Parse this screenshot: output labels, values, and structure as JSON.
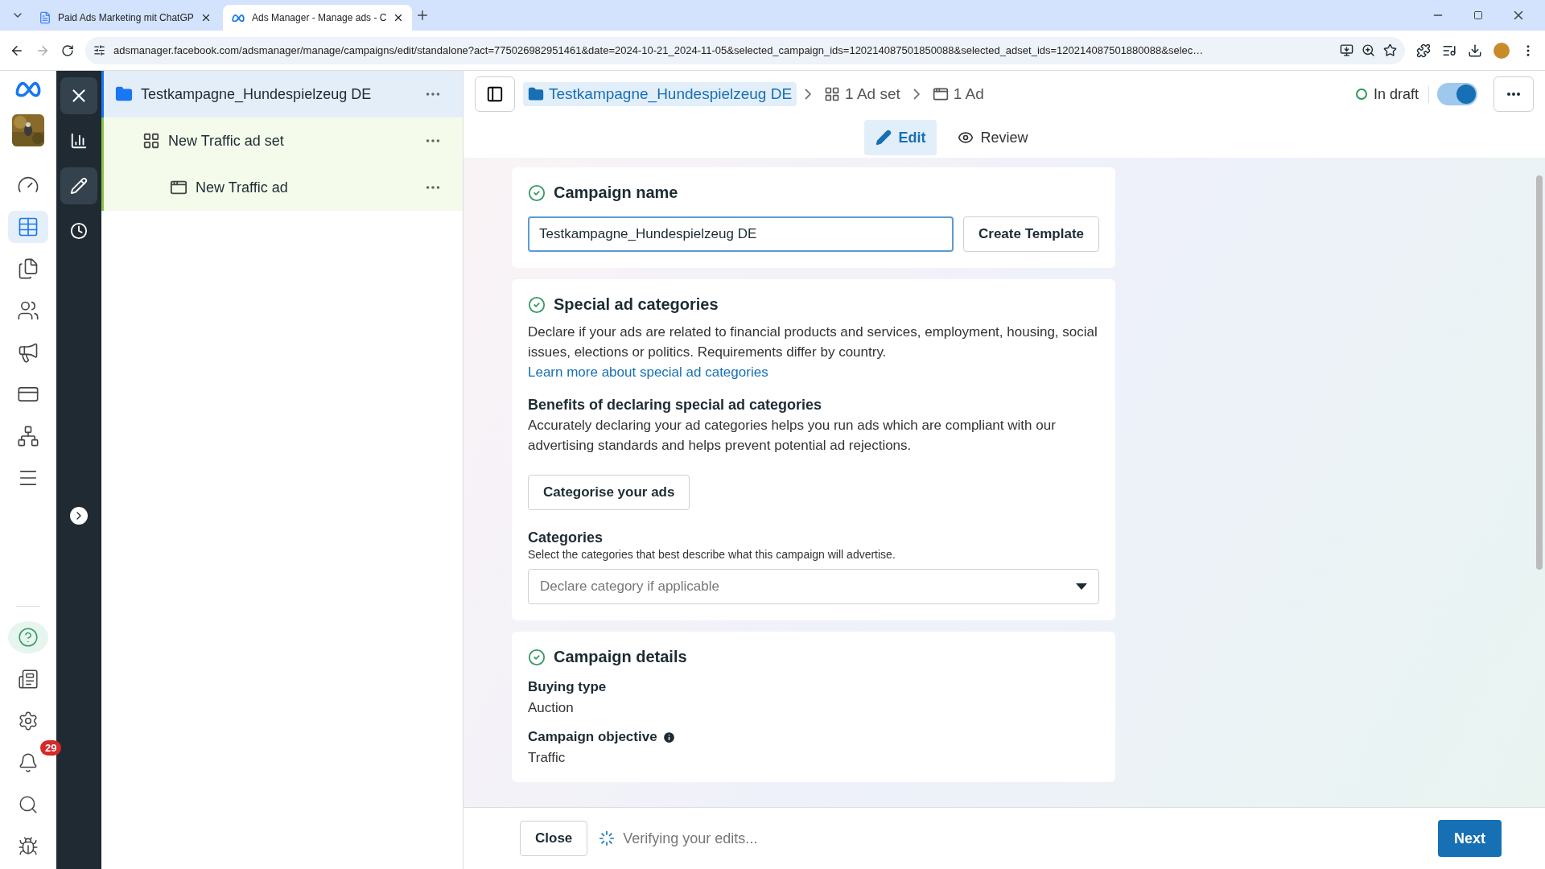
{
  "browser": {
    "tabs": [
      {
        "title": "Paid Ads Marketing mit ChatGP",
        "selected": false
      },
      {
        "title": "Ads Manager - Manage ads - C",
        "selected": true
      }
    ],
    "url": "adsmanager.facebook.com/adsmanager/manage/campaigns/edit/standalone?act=775026982951461&date=2024-10-21_2024-11-05&selected_campaign_ids=120214087501850088&selected_adset_ids=120214087501880088&selec…"
  },
  "rail": {
    "top_items": [
      {
        "selected": false
      },
      {
        "selected": true
      },
      {
        "selected": false
      },
      {
        "selected": false
      },
      {
        "selected": false
      },
      {
        "selected": false
      },
      {
        "selected": false
      },
      {
        "selected": false
      }
    ],
    "bottom_items": [
      {
        "selected": true
      },
      {
        "selected": false
      },
      {
        "selected": false
      },
      {
        "selected": false,
        "badge": "29"
      },
      {
        "selected": false
      },
      {
        "selected": false
      }
    ]
  },
  "tool_rail": {
    "items": [
      {
        "selected": false
      },
      {
        "selected": true
      },
      {
        "selected": false
      }
    ]
  },
  "tree": [
    {
      "name": "Testkampagne_Hundespielzeug DE",
      "kind": "campaign",
      "selected": true,
      "children": [
        {
          "name": "New Traffic ad set",
          "kind": "adset",
          "selected": false,
          "children": [
            {
              "name": "New Traffic ad",
              "kind": "ad",
              "selected": false
            }
          ]
        }
      ]
    }
  ],
  "header": {
    "breadcrumbs": [
      {
        "label": "Testkampagne_Hundespielzeug DE",
        "kind": "campaign",
        "selected": true
      },
      {
        "label": "1 Ad set",
        "kind": "adset",
        "selected": false
      },
      {
        "label": "1 Ad",
        "kind": "ad",
        "selected": false
      }
    ],
    "status": "In draft",
    "toggle_on": true
  },
  "mode_tabs": [
    {
      "label": "Edit",
      "selected": true
    },
    {
      "label": "Review",
      "selected": false
    }
  ],
  "campaign_name": {
    "title": "Campaign name",
    "value": "Testkampagne_Hundespielzeug DE",
    "button": "Create Template"
  },
  "special": {
    "title": "Special ad categories",
    "text": "Declare if your ads are related to financial products and services, employment, housing, social issues, elections or politics. Requirements differ by country.",
    "link": "Learn more about special ad categories",
    "benefits_title": "Benefits of declaring special ad categories",
    "benefits_text": "Accurately declaring your ad categories helps you run ads which are compliant with our advertising standards and helps prevent potential ad rejections.",
    "button": "Categorise your ads",
    "categories_label": "Categories",
    "categories_hint": "Select the categories that best describe what this campaign will advertise.",
    "categories_placeholder": "Declare category if applicable"
  },
  "details": {
    "title": "Campaign details",
    "fields": [
      {
        "label": "Buying type",
        "value": "Auction",
        "info": false
      },
      {
        "label": "Campaign objective",
        "value": "Traffic",
        "info": true
      }
    ]
  },
  "footer": {
    "close": "Close",
    "status": "Verifying your edits...",
    "next": "Next"
  }
}
